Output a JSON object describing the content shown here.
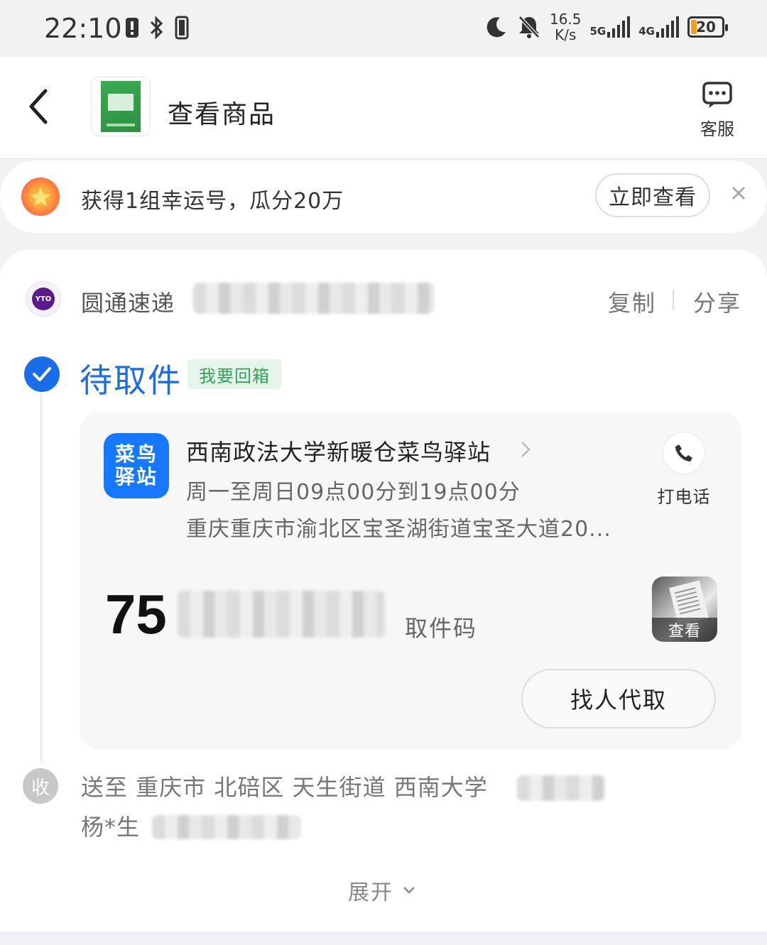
{
  "status_bar": {
    "time": "22:10",
    "speed_value": "16.5",
    "speed_unit": "K/s",
    "net1": "5G",
    "net2": "4G",
    "battery": "20",
    "icons": [
      "alert-icon",
      "bluetooth-icon",
      "vibrate-icon",
      "moon-icon",
      "mute-bell-icon",
      "signal-icon",
      "battery-icon"
    ]
  },
  "header": {
    "title": "查看商品",
    "customer_service_label": "客服"
  },
  "lucky_banner": {
    "text": "获得1组幸运号，瓜分20万",
    "button_label": "立即查看"
  },
  "shipment": {
    "carrier": "圆通速递",
    "copy_label": "复制",
    "share_label": "分享",
    "status": "待取件",
    "return_tag": "我要回箱"
  },
  "pickup": {
    "logo_line1": "菜鸟",
    "logo_line2": "驿站",
    "station_name": "西南政法大学新暖仓菜鸟驿站",
    "hours": "周一至周日09点00分到19点00分",
    "address": "重庆重庆市渝北区宝圣湖街道宝圣大道20...",
    "call_label": "打电话",
    "code_prefix": "75",
    "code_label": "取件码",
    "view_label": "查看",
    "proxy_button": "找人代取"
  },
  "recipient": {
    "badge": "收",
    "address": "送至 重庆市 北碚区 天生街道 西南大学",
    "name": "杨*生"
  },
  "expand_label": "展开",
  "colors": {
    "accent_blue": "#1a6de8",
    "station_blue": "#1677ff",
    "tag_green": "#33a35a",
    "tag_green_bg": "#e6f5ea"
  }
}
